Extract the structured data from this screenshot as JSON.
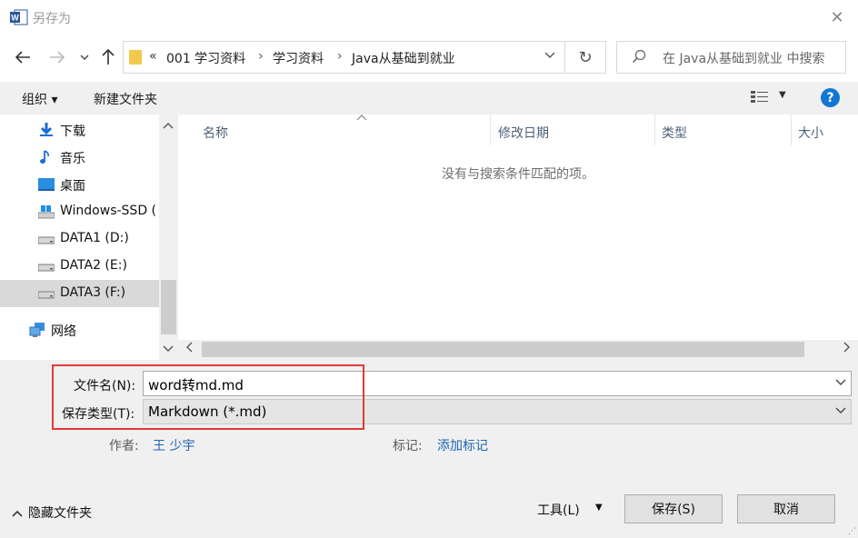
{
  "window": {
    "title": "另存为"
  },
  "address": {
    "overflow": "«",
    "crumbs": [
      "001 学习资料",
      "学习资料",
      "Java从基础到就业"
    ]
  },
  "search": {
    "placeholder": "在 Java从基础到就业 中搜索"
  },
  "toolbar": {
    "organize": "组织 ▾",
    "new_folder": "新建文件夹"
  },
  "sidebar": {
    "items": [
      {
        "label": "下载",
        "icon": "download-icon"
      },
      {
        "label": "音乐",
        "icon": "music-icon"
      },
      {
        "label": "桌面",
        "icon": "desktop-icon"
      },
      {
        "label": "Windows-SSD (",
        "icon": "drive-icon"
      },
      {
        "label": "DATA1 (D:)",
        "icon": "drive-icon"
      },
      {
        "label": "DATA2 (E:)",
        "icon": "drive-icon"
      },
      {
        "label": "DATA3 (F:)",
        "icon": "drive-icon",
        "selected": true
      },
      {
        "label": "网络",
        "icon": "network-icon"
      }
    ]
  },
  "columns": [
    "名称",
    "修改日期",
    "类型",
    "大小"
  ],
  "empty_message": "没有与搜索条件匹配的项。",
  "form": {
    "filename_label": "文件名(N):",
    "filename_value": "word转md.md",
    "filetype_label": "保存类型(T):",
    "filetype_value": "Markdown (*.md)",
    "author_label": "作者:",
    "author_value": "王 少宇",
    "tags_label": "标记:",
    "tags_value": "添加标记"
  },
  "footer": {
    "hide_folders": "隐藏文件夹",
    "tools": "工具(L)",
    "save": "保存(S)",
    "cancel": "取消"
  },
  "colors": {
    "highlight_box": "#e03a3a",
    "link": "#1d65b5",
    "help": "#1476d3"
  }
}
